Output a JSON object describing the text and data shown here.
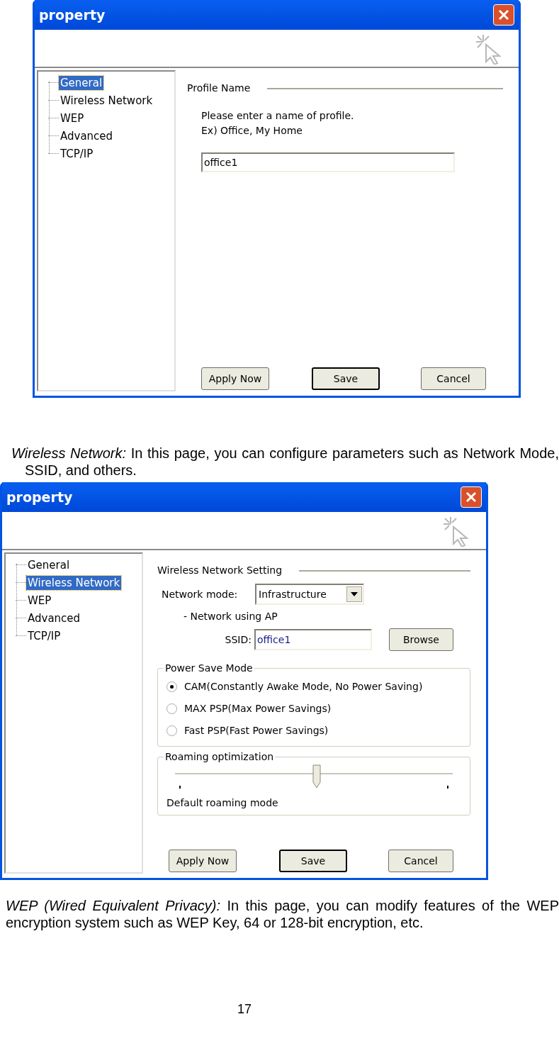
{
  "blocks": [
    {
      "kind": "dialog",
      "title": "property",
      "tree": [
        {
          "label": "General",
          "selected": true
        },
        {
          "label": "Wireless Network",
          "selected": false
        },
        {
          "label": "WEP",
          "selected": false
        },
        {
          "label": "Advanced",
          "selected": false
        },
        {
          "label": "TCP/IP",
          "selected": false
        }
      ],
      "panel": {
        "kind": "general",
        "section_title": "Profile Name",
        "instructions": [
          "Please enter a name of profile.",
          "Ex) Office, My Home"
        ],
        "profile_name": "office1"
      },
      "buttons": [
        {
          "label": "Apply Now",
          "default": false
        },
        {
          "label": "Save",
          "default": true
        },
        {
          "label": "Cancel",
          "default": false
        }
      ]
    },
    {
      "kind": "paragraph",
      "text": "*Wireless Network:* In this page, you can configure parameters such as Network Mode, SSID, and others."
    },
    {
      "kind": "dialog",
      "title": "property",
      "tree": [
        {
          "label": "General",
          "selected": false
        },
        {
          "label": "Wireless Network",
          "selected": true
        },
        {
          "label": "WEP",
          "selected": false
        },
        {
          "label": "Advanced",
          "selected": false
        },
        {
          "label": "TCP/IP",
          "selected": false
        }
      ],
      "panel": {
        "kind": "wireless",
        "section_title": "Wireless Network Setting",
        "network_mode_label": "Network mode:",
        "network_mode": "Infrastructure",
        "mode_note": "- Network using AP",
        "ssid_label": "SSID:",
        "ssid": "office1",
        "browse_button": "Browse",
        "power_save": {
          "title": "Power Save Mode",
          "options": [
            {
              "label": "CAM(Constantly Awake Mode, No Power Saving)",
              "selected": true
            },
            {
              "label": "MAX PSP(Max Power Savings)",
              "selected": false
            },
            {
              "label": "Fast PSP(Fast Power Savings)",
              "selected": false
            }
          ]
        },
        "roaming": {
          "title": "Roaming optimization",
          "level": 0.51,
          "caption": "Default roaming mode"
        }
      },
      "buttons": [
        {
          "label": "Apply Now",
          "default": false
        },
        {
          "label": "Save",
          "default": true
        },
        {
          "label": "Cancel",
          "default": false
        }
      ]
    },
    {
      "kind": "paragraph",
      "text": "*WEP (Wired Equivalent Privacy):* In this page, you can modify features of the WEP encryption system such as WEP Key, 64 or 128-bit encryption, etc."
    },
    {
      "kind": "page_number",
      "text": "17"
    }
  ]
}
